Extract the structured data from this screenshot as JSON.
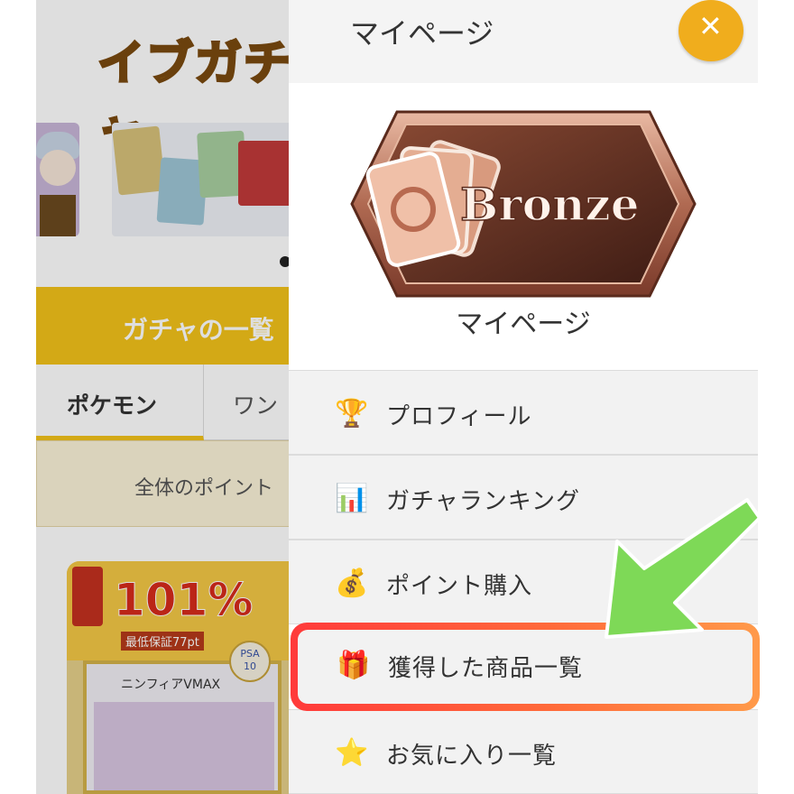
{
  "background": {
    "logo_text": "イブガチャ",
    "gacha_list_label": "ガチャの一覧",
    "tabs": [
      {
        "label": "ポケモン"
      },
      {
        "label": "ワン"
      }
    ],
    "point_button_label": "全体のポイント",
    "product": {
      "percent": "101%",
      "guarantee": "最低保証77pt",
      "card_name": "ニンフィアVMAX",
      "psa": "PSA",
      "grade": "10"
    }
  },
  "drawer": {
    "title": "マイページ",
    "close_icon": "close-icon",
    "rank_badge": {
      "text": "Bronze",
      "color": "#9a5a44"
    },
    "mypage_label": "マイページ",
    "menu": [
      {
        "icon": "trophy-icon",
        "glyph": "🏆",
        "label": "プロフィール"
      },
      {
        "icon": "bar-chart-icon",
        "glyph": "📊",
        "label": "ガチャランキング"
      },
      {
        "icon": "money-bag-icon",
        "glyph": "💰",
        "label": "ポイント購入"
      },
      {
        "icon": "gift-icon",
        "glyph": "🎁",
        "label": "獲得した商品一覧"
      },
      {
        "icon": "star-icon",
        "glyph": "⭐",
        "label": "お気に入り一覧"
      }
    ]
  },
  "colors": {
    "accent_gold": "#f3c31a",
    "close_button": "#f0ad1d",
    "highlight_red": "#ff3a3a",
    "highlight_orange": "#ff9a4a",
    "arrow_green": "#7ed957"
  }
}
